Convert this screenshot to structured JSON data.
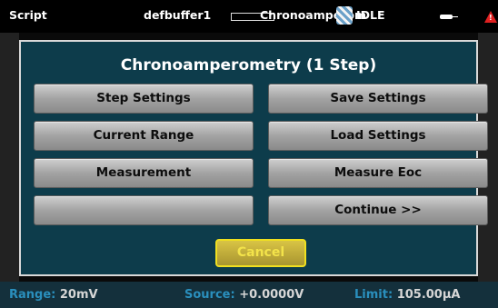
{
  "topbar": {
    "mode": "Script",
    "buffer": "defbuffer1",
    "function": "Chronoamperom",
    "state": "IDLE",
    "warning_glyph": "!"
  },
  "dialog": {
    "title": "Chronoamperometry (1 Step)",
    "buttons": {
      "step_settings": "Step Settings",
      "save_settings": "Save Settings",
      "current_range": "Current Range",
      "load_settings": "Load Settings",
      "measurement": "Measurement",
      "measure_eoc": "Measure Eoc",
      "empty": "",
      "continue": "Continue >>"
    },
    "cancel": "Cancel"
  },
  "statusbar": {
    "range_label": "Range:",
    "range_value": "20mV",
    "source_label": "Source:",
    "source_value": "+0.0000V",
    "limit_label": "Limit:",
    "limit_value": "105.00µA"
  },
  "colors": {
    "dialog_bg": "#0d3c4b",
    "status_label": "#2a8fbd",
    "cancel_text": "#f3e34a",
    "warning": "#e02020"
  },
  "icons": [
    "person-activity-icon",
    "plug-icon",
    "warning-icon"
  ]
}
